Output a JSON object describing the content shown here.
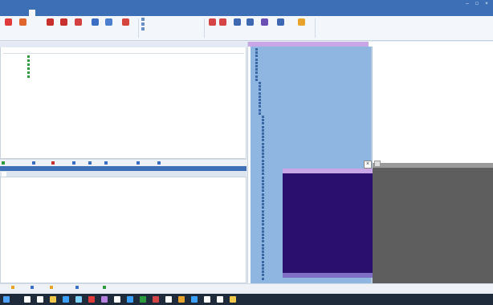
{
  "window": {
    "title": ""
  },
  "menu": {
    "tabs": [
      {
        "label": "",
        "active": false
      },
      {
        "label": "",
        "active": true
      },
      {
        "label": "",
        "active": false
      },
      {
        "label": "",
        "active": false
      },
      {
        "label": "",
        "active": false
      },
      {
        "label": "",
        "active": false
      }
    ]
  },
  "ribbon": {
    "buttons": [
      {
        "label": "",
        "icon": "connect-icon",
        "color": "#e03b3b"
      },
      {
        "label": "",
        "icon": "disconnect-icon",
        "color": "#e0662e"
      },
      {
        "label": "",
        "icon": "start-icon",
        "color": "#c7302c"
      },
      {
        "label": "",
        "icon": "stop-icon",
        "color": "#c7302c"
      },
      {
        "label": "",
        "icon": "record-icon",
        "color": "#d34040"
      },
      {
        "label": "",
        "icon": "arrow-down-icon",
        "color": "#3a6fc4"
      },
      {
        "label": "",
        "icon": "wizard-icon",
        "color": "#4c7fcd"
      },
      {
        "label": "",
        "icon": "import-icon",
        "color": "#d6453d"
      }
    ],
    "options": [
      "",
      "",
      ""
    ],
    "buttons2": [
      {
        "label": "",
        "icon": "circle-icon",
        "color": "#d64545"
      },
      {
        "label": "",
        "icon": "circle-icon",
        "color": "#d64545"
      },
      {
        "label": "",
        "icon": "question-icon",
        "color": "#3e68b1"
      },
      {
        "label": "",
        "icon": "filter-icon",
        "color": "#3e68b1"
      },
      {
        "label": "",
        "icon": "funnel-icon",
        "color": "#6a4fb5"
      },
      {
        "label": "",
        "icon": "settings-icon",
        "color": "#3e68b1"
      },
      {
        "label": "",
        "icon": "warning-icon",
        "color": "#e7a32b"
      }
    ],
    "groups": [
      "",
      "",
      "",
      "",
      "",
      ""
    ]
  },
  "left_pane": {
    "tabs": [
      "",
      "",
      "",
      "",
      ""
    ],
    "columns": [
      "",
      "",
      "",
      "",
      ""
    ],
    "rows": [
      [
        "",
        "",
        "",
        "",
        ""
      ],
      [
        "",
        "",
        "",
        "",
        ""
      ],
      [
        "",
        "",
        "",
        "",
        ""
      ],
      [
        "",
        "",
        "",
        "",
        ""
      ],
      [
        "",
        "",
        "",
        "",
        ""
      ],
      [
        "",
        "",
        "",
        "",
        ""
      ]
    ]
  },
  "left_toolbar": {
    "items": [
      {
        "label": "",
        "icon": "add-icon",
        "color": "#2e9b3e"
      },
      {
        "label": "",
        "icon": "edit-icon",
        "color": "#3a6fc4"
      },
      {
        "label": "",
        "icon": "delete-icon",
        "color": "#c7302c"
      },
      {
        "label": "",
        "icon": "copy-icon",
        "color": "#3a6fc4"
      },
      {
        "label": "",
        "icon": "paste-icon",
        "color": "#3a6fc4"
      },
      {
        "label": "",
        "icon": "list-icon",
        "color": "#3a6fc4"
      },
      {
        "label": "",
        "icon": "export-icon",
        "color": "#3a6fc4"
      },
      {
        "label": "",
        "icon": "print-icon",
        "color": "#3a6fc4"
      }
    ]
  },
  "output": {
    "title": "",
    "tabs": [
      "",
      ""
    ],
    "columns": [
      "",
      "",
      "",
      "",
      "",
      "",
      "",
      "",
      ""
    ]
  },
  "right_pane": {
    "tree_items": [
      "",
      "",
      "",
      "",
      "",
      "",
      "",
      "",
      "",
      "",
      "",
      "",
      "",
      "",
      "",
      "",
      "",
      "",
      "",
      "",
      "",
      "",
      "",
      "",
      "",
      "",
      "",
      "",
      "",
      "",
      "",
      "",
      "",
      "",
      "",
      "",
      "",
      "",
      "",
      "",
      "",
      "",
      "",
      "",
      "",
      "",
      "",
      "",
      "",
      "",
      "",
      "",
      "",
      "",
      "",
      "",
      "",
      "",
      "",
      "",
      "",
      "",
      "",
      "",
      "",
      "",
      "",
      "",
      ""
    ]
  },
  "console": {
    "title": "",
    "lines": [
      "",
      "",
      "",
      "",
      "",
      "",
      "",
      "",
      "",
      "",
      "",
      "",
      ""
    ]
  },
  "status": {
    "items": [
      {
        "label": "",
        "icon": "warning-icon",
        "color": "#e7a32b"
      },
      {
        "label": "",
        "icon": "info-icon",
        "color": "#3a6fc4"
      },
      {
        "label": "",
        "icon": "bell-icon",
        "color": "#e7a32b"
      },
      {
        "label": "",
        "icon": "user-icon",
        "color": "#3a6fc4"
      },
      {
        "label": "",
        "icon": "check-icon",
        "color": "#2e9b3e"
      }
    ],
    "right_text": ""
  },
  "taskbar": {
    "icons": [
      {
        "name": "start-icon",
        "color": "#4fa3ff"
      },
      {
        "name": "search-icon",
        "color": "#ffffff"
      },
      {
        "name": "task-view-icon",
        "color": "#ffffff"
      },
      {
        "name": "folder-icon",
        "color": "#f2c84b"
      },
      {
        "name": "browser-icon",
        "color": "#3ba0ff"
      },
      {
        "name": "app-icon",
        "color": "#7fd1ff"
      },
      {
        "name": "app-icon",
        "color": "#e03b3b"
      },
      {
        "name": "app-icon",
        "color": "#b67fe0"
      },
      {
        "name": "app-icon",
        "color": "#ffffff"
      },
      {
        "name": "app-icon",
        "color": "#3ba0ff"
      },
      {
        "name": "app-icon",
        "color": "#2e9b3e"
      },
      {
        "name": "app-icon",
        "color": "#d64545"
      },
      {
        "name": "app-icon",
        "color": "#ffffff"
      },
      {
        "name": "app-icon",
        "color": "#e7a32b"
      },
      {
        "name": "app-icon",
        "color": "#3ba0ff"
      },
      {
        "name": "app-icon",
        "color": "#ffffff"
      },
      {
        "name": "app-icon",
        "color": "#ffffff"
      },
      {
        "name": "app-icon",
        "color": "#f2c84b"
      }
    ],
    "clock_time": "",
    "clock_date": ""
  }
}
